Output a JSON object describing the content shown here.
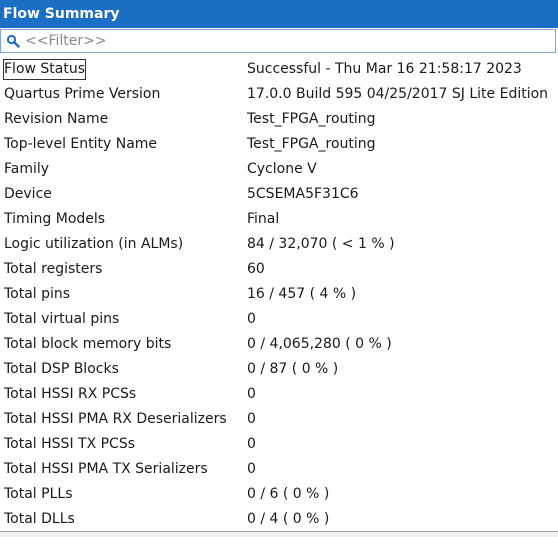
{
  "panel": {
    "title": "Flow Summary",
    "title_bar_color": "#1a6fc4"
  },
  "filter": {
    "icon": "search-icon",
    "placeholder": "<<Filter>>",
    "value": ""
  },
  "rows": [
    {
      "label": "Flow Status",
      "value": "Successful - Thu Mar 16 21:58:17 2023"
    },
    {
      "label": "Quartus Prime Version",
      "value": "17.0.0 Build 595 04/25/2017 SJ Lite Edition"
    },
    {
      "label": "Revision Name",
      "value": "Test_FPGA_routing"
    },
    {
      "label": "Top-level Entity Name",
      "value": "Test_FPGA_routing"
    },
    {
      "label": "Family",
      "value": "Cyclone V"
    },
    {
      "label": "Device",
      "value": "5CSEMA5F31C6"
    },
    {
      "label": "Timing Models",
      "value": "Final"
    },
    {
      "label": "Logic utilization (in ALMs)",
      "value": "84 / 32,070 ( < 1 % )"
    },
    {
      "label": "Total registers",
      "value": "60"
    },
    {
      "label": "Total pins",
      "value": "16 / 457 ( 4 % )"
    },
    {
      "label": "Total virtual pins",
      "value": "0"
    },
    {
      "label": "Total block memory bits",
      "value": "0 / 4,065,280 ( 0 % )"
    },
    {
      "label": "Total DSP Blocks",
      "value": "0 / 87 ( 0 % )"
    },
    {
      "label": "Total HSSI RX PCSs",
      "value": "0"
    },
    {
      "label": "Total HSSI PMA RX Deserializers",
      "value": "0"
    },
    {
      "label": "Total HSSI TX PCSs",
      "value": "0"
    },
    {
      "label": "Total HSSI PMA TX Serializers",
      "value": "0"
    },
    {
      "label": "Total PLLs",
      "value": "0 / 6 ( 0 % )"
    },
    {
      "label": "Total DLLs",
      "value": "0 / 4 ( 0 % )"
    }
  ]
}
